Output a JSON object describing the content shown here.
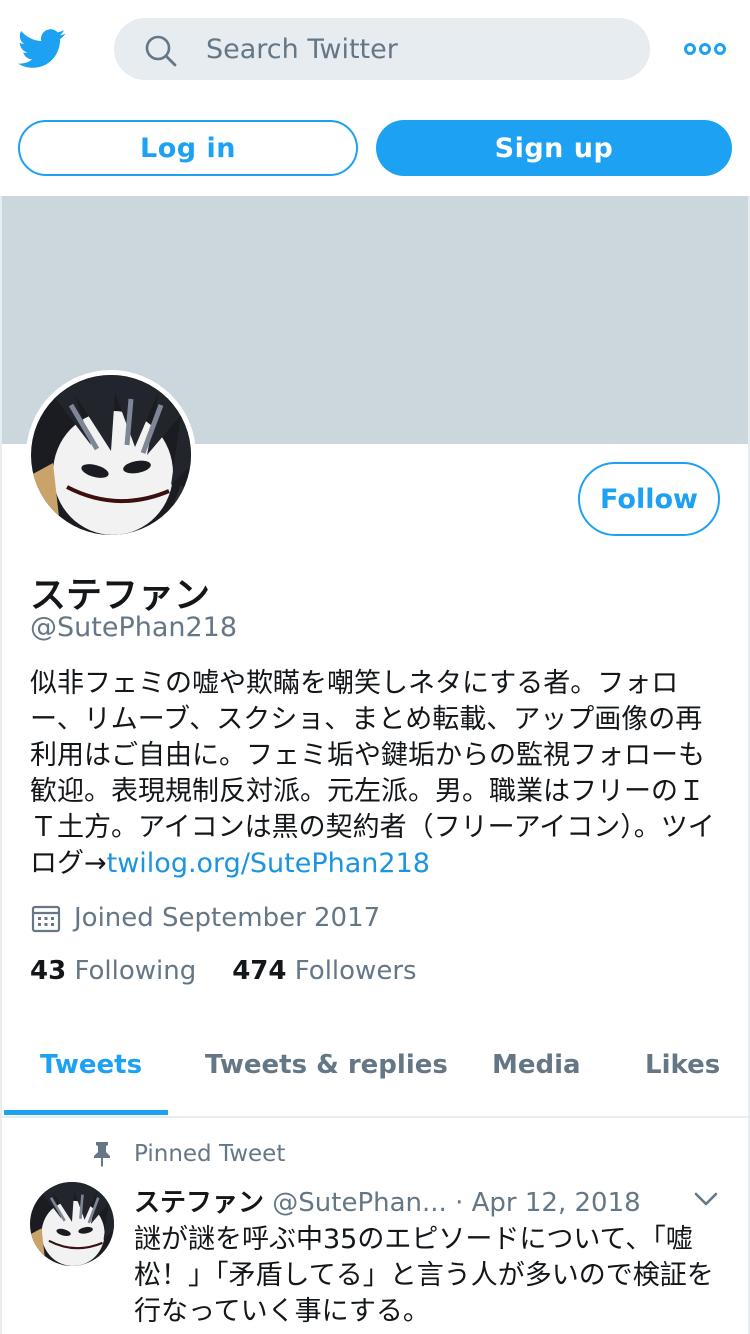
{
  "header": {
    "search_placeholder": "Search Twitter",
    "login_label": "Log in",
    "signup_label": "Sign up"
  },
  "profile": {
    "name": "ステファン",
    "handle": "@SutePhan218",
    "follow_label": "Follow",
    "bio_text": "似非フェミの嘘や欺瞞を嘲笑しネタにする者。フォロー、リムーブ、スクショ、まとめ転載、アップ画像の再利用はご自由に。フェミ垢や鍵垢からの監視フォローも歓迎。表現規制反対派。元左派。男。職業はフリーのＩＴ土方。アイコンは黒の契約者（フリーアイコン）。ツイログ→",
    "bio_link": "twilog.org/SutePhan218",
    "joined": "Joined September 2017",
    "following_count": "43",
    "following_label": "Following",
    "followers_count": "474",
    "followers_label": "Followers"
  },
  "tabs": [
    {
      "label": "Tweets"
    },
    {
      "label": "Tweets & replies"
    },
    {
      "label": "Media"
    },
    {
      "label": "Likes"
    }
  ],
  "pinned_tweet": {
    "pinned_label": "Pinned Tweet",
    "name": "ステファン",
    "handle": "@SutePhan...",
    "separator": "·",
    "date": "Apr 12, 2018",
    "text": "謎が謎を呼ぶ中35のエピソードについて、「嘘松！」「矛盾してる」と言う人が多いので検証を行なっていく事にする。"
  },
  "colors": {
    "accent": "#1da1f2",
    "banner": "#ccd6dd",
    "secondary_text": "#657786"
  }
}
